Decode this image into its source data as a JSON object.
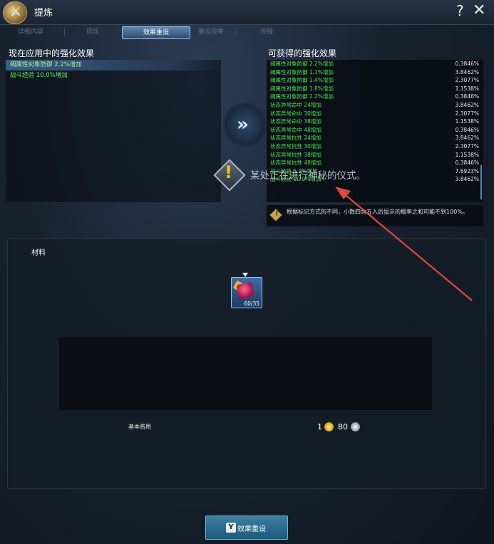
{
  "header": {
    "title": "提炼",
    "help_glyph": "?",
    "close_glyph": "✕"
  },
  "tabs": [
    {
      "label": "详细内容",
      "active": false
    },
    {
      "label": "提炼",
      "active": false
    },
    {
      "label": "效果重设",
      "active": true
    },
    {
      "label": "重设效果",
      "active": false
    },
    {
      "label": "传授",
      "active": false
    }
  ],
  "current_effects": {
    "title": "现在应用中的强化效果",
    "rows": [
      "阈属性对象防御 2.2%增加",
      "战斗经验 10.0%增加"
    ]
  },
  "arrow_button": "»",
  "possible_effects": {
    "title": "可获得的强化效果",
    "rows": [
      {
        "label": "阈属性对象防御 2.2%增加",
        "value": "0.3846%"
      },
      {
        "label": "阈属性对象防御 1.1%增加",
        "value": "3.8462%"
      },
      {
        "label": "阈属性对象防御 1.4%增加",
        "value": "2.3077%"
      },
      {
        "label": "阈属性对象防御 1.8%增加",
        "value": "1.1538%"
      },
      {
        "label": "阈属性对象防御 2.2%增加",
        "value": "0.3846%"
      },
      {
        "label": "状态异常命中 24增加",
        "value": "3.8462%"
      },
      {
        "label": "状态异常命中 30增加",
        "value": "2.3077%"
      },
      {
        "label": "状态异常命中 38增加",
        "value": "1.1538%"
      },
      {
        "label": "状态异常命中 48增加",
        "value": "0.3846%"
      },
      {
        "label": "状态异常抗性 24增加",
        "value": "3.8462%"
      },
      {
        "label": "状态异常抗性 30增加",
        "value": "2.3077%"
      },
      {
        "label": "状态异常抗性 38增加",
        "value": "1.1538%"
      },
      {
        "label": "状态异常抗性 48增加",
        "value": "0.3846%"
      },
      {
        "label": "战斗经验 5.0%增加",
        "value": "7.6923%"
      },
      {
        "label": "战斗经验 10.0%增加",
        "value": "3.8462%"
      }
    ]
  },
  "note": {
    "text": "根据标记方式的不同，小数四舍五入后显示的概率之和可能不到100%。"
  },
  "overlay": {
    "text": "某处正在进行神秘的仪式。"
  },
  "material": {
    "title": "材料",
    "item_count": "60/35",
    "cost_label": "基本费用",
    "cost_gold": "1",
    "cost_silver": "80"
  },
  "action": {
    "key": "Y",
    "label": "效果重设"
  },
  "colors": {
    "effect_green": "#4ee04a",
    "accent_blue": "#4b88c9",
    "annotation_red": "#e0473f"
  }
}
